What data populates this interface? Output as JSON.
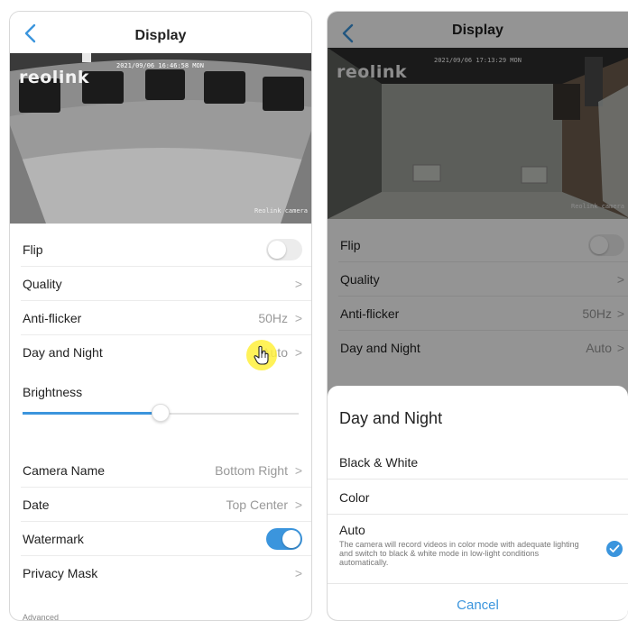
{
  "colors": {
    "accent": "#3b95dd",
    "divider": "#ececec",
    "hover_cursor": "#fff03c"
  },
  "left": {
    "header": {
      "title": "Display",
      "back_icon": "chevron-left-icon"
    },
    "video": {
      "logo": "reolink",
      "timestamp": "2021/09/06 16:46:58 MON",
      "camera_name": "Reolink camera"
    },
    "rows": {
      "flip": {
        "label": "Flip",
        "on": false
      },
      "quality": {
        "label": "Quality"
      },
      "anti_flicker": {
        "label": "Anti-flicker",
        "value": "50Hz"
      },
      "day_night": {
        "label": "Day and Night",
        "value": "Auto"
      },
      "brightness": {
        "label": "Brightness",
        "level": 0.5
      },
      "camera_name": {
        "label": "Camera Name",
        "value": "Bottom Right"
      },
      "date": {
        "label": "Date",
        "value": "Top Center"
      },
      "watermark": {
        "label": "Watermark",
        "on": true
      },
      "privacy_mask": {
        "label": "Privacy Mask"
      }
    },
    "advanced_label": "Advanced",
    "chevron": ">"
  },
  "right": {
    "header": {
      "title": "Display",
      "back_icon": "chevron-left-icon"
    },
    "video": {
      "logo": "reolink",
      "timestamp": "2021/09/06 17:13:29 MON",
      "camera_name": "Reolink camera"
    },
    "rows": {
      "flip": {
        "label": "Flip",
        "on": false
      },
      "quality": {
        "label": "Quality"
      },
      "anti_flicker": {
        "label": "Anti-flicker",
        "value": "50Hz"
      },
      "day_night": {
        "label": "Day and Night",
        "value": "Auto"
      }
    },
    "sheet": {
      "title": "Day and Night",
      "options": {
        "bw": "Black & White",
        "color": "Color",
        "auto": "Auto",
        "auto_desc": "The camera will record videos in color mode with adequate lighting and switch to black & white mode in low-light conditions automatically."
      },
      "selected": "Auto",
      "cancel": "Cancel"
    },
    "chevron": ">"
  }
}
